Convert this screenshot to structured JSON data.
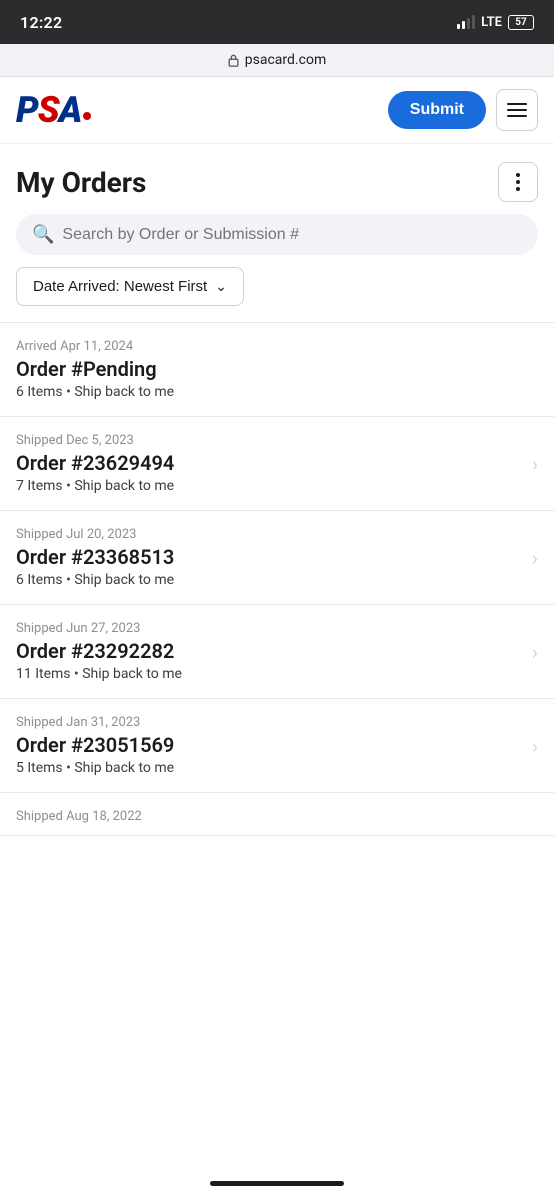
{
  "statusBar": {
    "time": "12:22",
    "signal": "LTE",
    "battery": "57"
  },
  "browserBar": {
    "url": "psacard.com"
  },
  "header": {
    "submitLabel": "Submit",
    "logoText": "PSA"
  },
  "pageHeader": {
    "title": "My Orders"
  },
  "search": {
    "placeholder": "Search by Order or Submission #"
  },
  "sort": {
    "label": "Date Arrived: Newest First"
  },
  "orders": [
    {
      "status": "Arrived Apr 11, 2024",
      "number": "Order #Pending",
      "detail": "6 Items • Ship back to me",
      "hasChevron": false
    },
    {
      "status": "Shipped Dec 5, 2023",
      "number": "Order #23629494",
      "detail": "7 Items • Ship back to me",
      "hasChevron": true
    },
    {
      "status": "Shipped Jul 20, 2023",
      "number": "Order #23368513",
      "detail": "6 Items • Ship back to me",
      "hasChevron": true
    },
    {
      "status": "Shipped Jun 27, 2023",
      "number": "Order #23292282",
      "detail": "11 Items • Ship back to me",
      "hasChevron": true
    },
    {
      "status": "Shipped Jan 31, 2023",
      "number": "Order #23051569",
      "detail": "5 Items • Ship back to me",
      "hasChevron": true
    },
    {
      "status": "Shipped Aug 18, 2022",
      "number": "",
      "detail": "",
      "hasChevron": false,
      "partial": true
    }
  ]
}
